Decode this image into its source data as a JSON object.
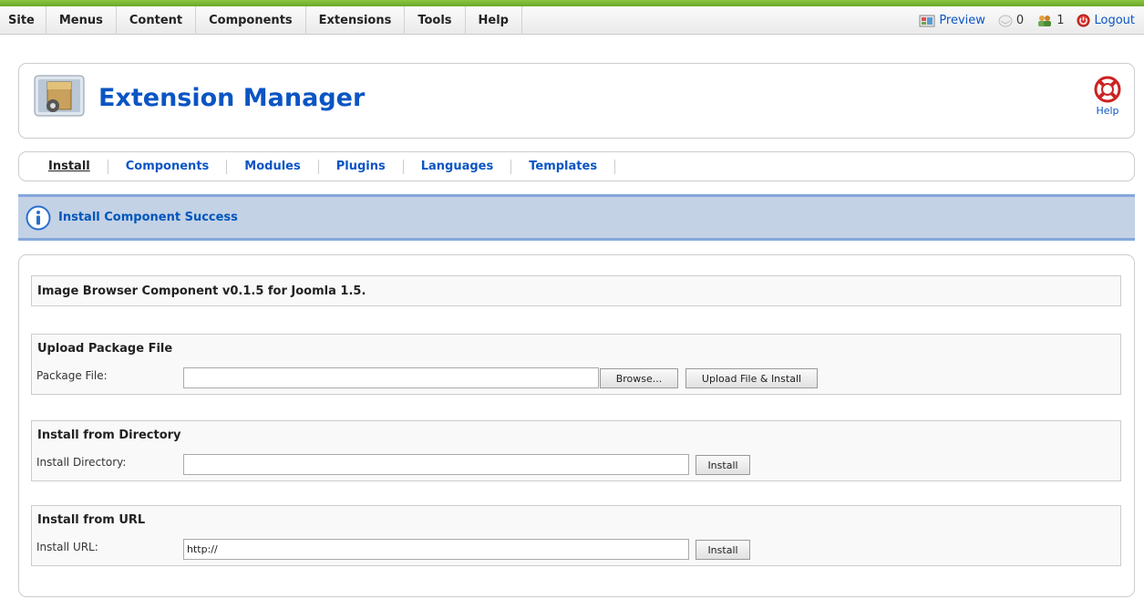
{
  "menu": {
    "items": [
      "Site",
      "Menus",
      "Content",
      "Components",
      "Extensions",
      "Tools",
      "Help"
    ]
  },
  "status": {
    "preview": "Preview",
    "messages_count": "0",
    "users_count": "1",
    "logout": "Logout"
  },
  "header": {
    "title": "Extension Manager",
    "help": "Help"
  },
  "submenu": {
    "items": [
      "Install",
      "Components",
      "Modules",
      "Plugins",
      "Languages",
      "Templates"
    ],
    "active": "Install"
  },
  "message": {
    "text": "Install Component Success"
  },
  "result": {
    "text": "Image Browser Component v0.1.5 for Joomla 1.5."
  },
  "upload": {
    "legend": "Upload Package File",
    "label": "Package File:",
    "value": "",
    "browse_label": "Browse...",
    "submit_label": "Upload File & Install"
  },
  "directory": {
    "legend": "Install from Directory",
    "label": "Install Directory:",
    "value": "",
    "submit_label": "Install"
  },
  "url": {
    "legend": "Install from URL",
    "label": "Install URL:",
    "value": "http://",
    "submit_label": "Install"
  },
  "colors": {
    "accent_green": "#8cc63f",
    "link_blue": "#0b55c4",
    "message_bg": "#c3d2e5",
    "message_border": "#84a7db"
  }
}
